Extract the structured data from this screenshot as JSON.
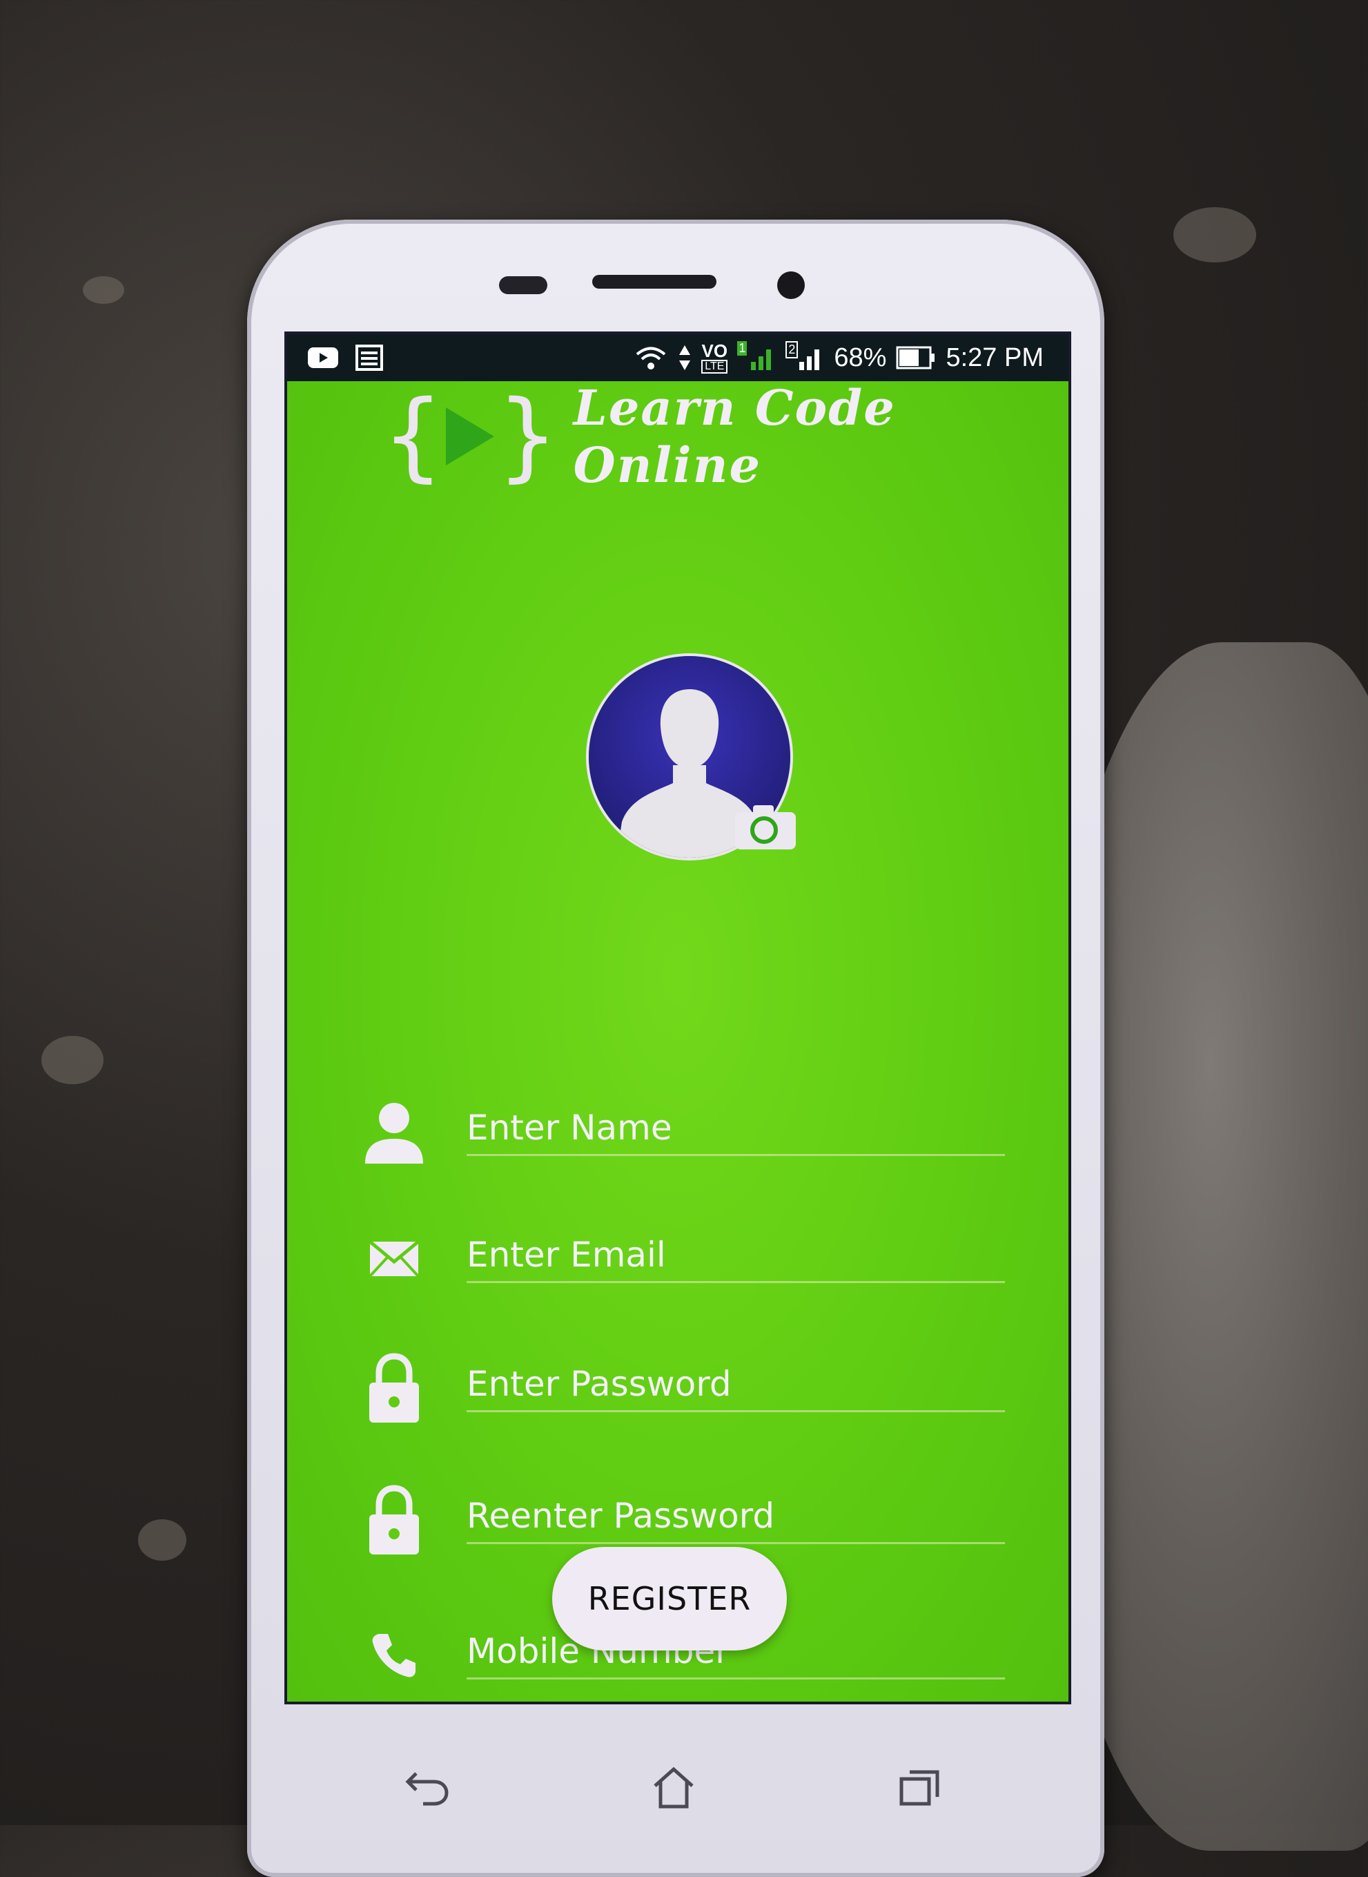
{
  "status_bar": {
    "battery": "68%",
    "time": "5:27 PM",
    "network_type": "VO",
    "network_sub": "LTE",
    "sim_1": "1",
    "sim_2": "2",
    "icons": [
      "youtube-icon",
      "news-icon",
      "wifi-icon",
      "data-arrows-icon",
      "volte-icon",
      "signal-icon",
      "battery-icon"
    ]
  },
  "app": {
    "logo_text": "Learn Code Online",
    "logo_icon": "play-brackets-icon"
  },
  "avatar": {
    "icon": "user-silhouette-icon",
    "badge_icon": "camera-icon"
  },
  "form": {
    "fields": [
      {
        "placeholder": "Enter Name",
        "icon": "person-icon"
      },
      {
        "placeholder": "Enter Email",
        "icon": "envelope-icon"
      },
      {
        "placeholder": "Enter Password",
        "icon": "lock-icon"
      },
      {
        "placeholder": "Reenter Password",
        "icon": "lock-icon"
      },
      {
        "placeholder": "Mobile Number",
        "icon": "phone-icon"
      }
    ],
    "register_label": "REGISTER"
  },
  "nav": {
    "icons": [
      "back-icon",
      "home-icon",
      "recents-icon"
    ]
  },
  "colors": {
    "app_background": "#5fcc12",
    "avatar_bg": "#23207e",
    "text": "#f4f0f8"
  }
}
